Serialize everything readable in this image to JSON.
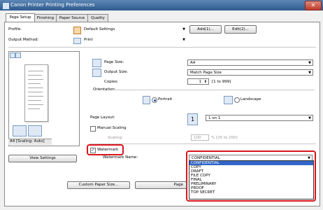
{
  "window": {
    "title": "Canon Printer Printing Preferences"
  },
  "tabs": [
    "Page Setup",
    "Finishing",
    "Paper Source",
    "Quality"
  ],
  "profile": {
    "label": "Profile:",
    "value": "Default Settings",
    "add_label": "Add(1)...",
    "edit_label": "Edit(2)..."
  },
  "output_method": {
    "label": "Output Method:",
    "value": "Print"
  },
  "preview": {
    "caption": "A4 [Scaling: Auto]",
    "view_settings_label": "View Settings"
  },
  "page_size": {
    "label": "Page Size:",
    "value": "A4"
  },
  "output_size": {
    "label": "Output Size:",
    "value": "Match Page Size"
  },
  "copies": {
    "label": "Copies:",
    "value": "1",
    "range": "[1 to 999]"
  },
  "orientation": {
    "label": "Orientation",
    "portrait": "Portrait",
    "landscape": "Landscape"
  },
  "page_layout": {
    "label": "Page Layout:",
    "value": "1 on 1"
  },
  "manual_scaling": {
    "label": "Manual Scaling",
    "scaling_label": "Scaling:",
    "value": "100",
    "range": "% [25 to 200]"
  },
  "watermark": {
    "label": "Watermark",
    "name_label": "Watermark Name:",
    "value": "CONFIDENTIAL",
    "options": [
      "CONFIDENTIAL",
      "COPY",
      "DRAFT",
      "FILE COPY",
      "FINAL",
      "PRELIMINARY",
      "PROOF",
      "TOP SECRET"
    ],
    "selected_index": 0
  },
  "footer": {
    "custom_paper_label": "Custom Paper Size...",
    "page_options_label": "Page",
    "ok_label": "OK",
    "cancel_label": "Cancel",
    "apply_label": "Apply",
    "help_label": "Help"
  },
  "colors": {
    "highlight_red": "#d9151d",
    "selection_blue": "#3166c7"
  }
}
